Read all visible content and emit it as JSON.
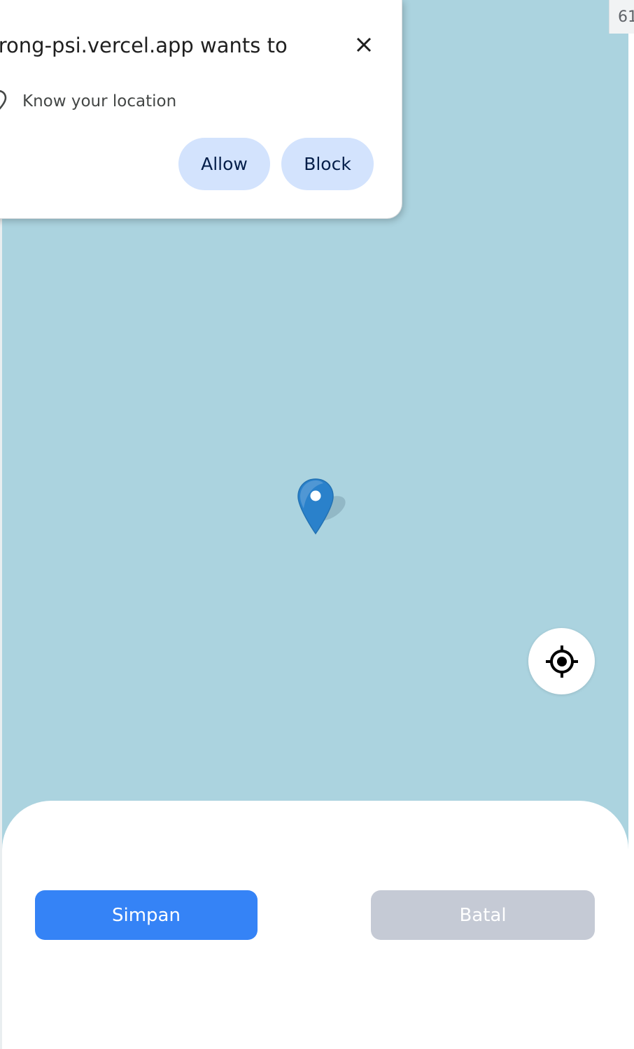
{
  "browser_permission": {
    "title": "arong-psi.vercel.app wants to",
    "permission_label": "Know your location",
    "allow_label": "Allow",
    "block_label": "Block",
    "close_icon": "close-icon",
    "location_icon": "location-pin-outline-icon"
  },
  "corner_tab": {
    "text": "61"
  },
  "map": {
    "water_color": "#abd3df",
    "marker_icon": "map-marker-icon",
    "marker_color": "#2a81cb"
  },
  "locate_button": {
    "icon": "crosshair-locate-icon"
  },
  "actions": {
    "save_label": "Simpan",
    "cancel_label": "Batal",
    "save_color": "#3583f6",
    "cancel_color": "#c5cad5"
  }
}
